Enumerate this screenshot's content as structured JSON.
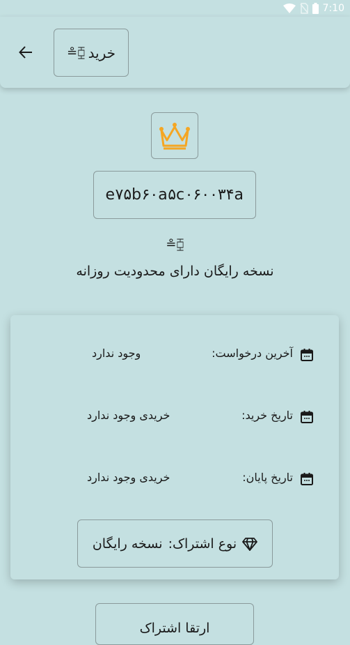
{
  "status_bar": {
    "time": "7:10",
    "icons": [
      "wifi-icon",
      "no-sim-icon",
      "battery-icon"
    ]
  },
  "appbar": {
    "title": "خرید",
    "title_glyph": "≗⧮"
  },
  "account": {
    "crown_icon": "crown-icon",
    "crown_color": "#f5a623",
    "id": "e۷۵b۶۰a۵c۰۶۰۰۳۴a",
    "user_glyph": "≗⧮",
    "note": "نسخه رایگان دارای محدودیت روزانه"
  },
  "info": {
    "rows": [
      {
        "label": "آخرین درخواست:",
        "value": "وجود ندارد"
      },
      {
        "label": "تاریخ خرید:",
        "value": "خریدی وجود ندارد"
      },
      {
        "label": "تاریخ پایان:",
        "value": "خریدی وجود ندارد"
      }
    ],
    "subscription": {
      "label": "نوع اشتراک:",
      "value": "نسخه رایگان",
      "icon": "diamond-icon"
    }
  },
  "bottom_button": {
    "label": "ارتقا اشتراک"
  }
}
